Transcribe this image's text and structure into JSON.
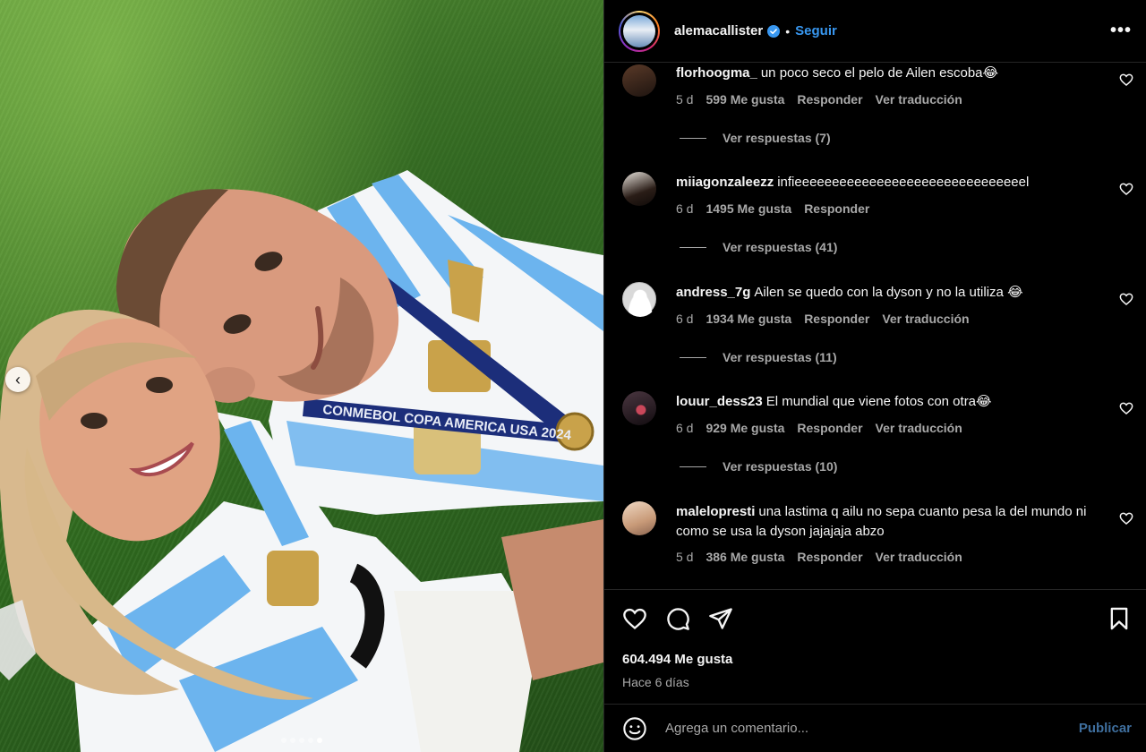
{
  "post": {
    "author": "alemacallister",
    "follow_label": "Seguir",
    "separator": "•",
    "more_label": "•••"
  },
  "media": {
    "prev_label": "‹",
    "slides_total": 5,
    "active_slide": 5,
    "description_icon": "photo",
    "medal_ribbon_text": "CONMEBOL COPA AMERICA USA 2024",
    "colors": {
      "grass": "#3f7a26",
      "shirt_blue": "#6cb4ee",
      "shirt_white": "#f4f6f8",
      "gold": "#c9a24a"
    }
  },
  "comments": [
    {
      "user": "florhoogma_",
      "text": "un poco seco el pelo de Ailen escoba😂",
      "age": "5 d",
      "likes": "599 Me gusta",
      "reply": "Responder",
      "translate": "Ver traducción",
      "replies": "Ver respuestas (7)"
    },
    {
      "user": "miiagonzaleezz",
      "text": "infieeeeeeeeeeeeeeeeeeeeeeeeeeeeeeel",
      "age": "6 d",
      "likes": "1495 Me gusta",
      "reply": "Responder",
      "translate": "",
      "replies": "Ver respuestas (41)"
    },
    {
      "user": "andress_7g",
      "text": "Ailen se quedo con la dyson y no la utiliza 😂",
      "age": "6 d",
      "likes": "1934 Me gusta",
      "reply": "Responder",
      "translate": "Ver traducción",
      "replies": "Ver respuestas (11)"
    },
    {
      "user": "louur_dess23",
      "text": "El mundial que viene fotos con otra😂",
      "age": "6 d",
      "likes": "929 Me gusta",
      "reply": "Responder",
      "translate": "Ver traducción",
      "replies": "Ver respuestas (10)"
    },
    {
      "user": "malelopresti",
      "text": "una lastima q ailu no sepa cuanto pesa la del mundo ni como se usa la dyson jajajaja abzo",
      "age": "5 d",
      "likes": "386 Me gusta",
      "reply": "Responder",
      "translate": "Ver traducción",
      "replies": ""
    }
  ],
  "actions": {
    "icons": [
      "heart-icon",
      "comment-icon",
      "share-icon",
      "bookmark-icon"
    ],
    "likes": "604.494 Me gusta",
    "time": "Hace 6 días"
  },
  "composer": {
    "placeholder": "Agrega un comentario...",
    "publish_label": "Publicar"
  },
  "colors": {
    "accent": "#3897f0",
    "muted": "#a8a8a8",
    "border": "#262626",
    "publish_disabled": "#3f6f9e"
  }
}
